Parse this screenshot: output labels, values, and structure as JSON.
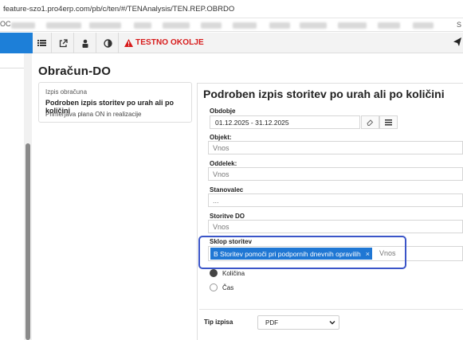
{
  "browser": {
    "url": "feature-szo1.pro4erp.com/pb/c/ten/#/TENAnalysis/TEN.REP.OBRDO"
  },
  "bookmarks": {
    "lead": "OC",
    "tail": "S"
  },
  "toolbar": {
    "buttons": [
      {
        "name": "list-icon"
      },
      {
        "name": "external-link-icon"
      },
      {
        "name": "user-lock-icon"
      },
      {
        "name": "contrast-icon"
      }
    ],
    "warning_label": "TESTNO OKOLJE",
    "warning_color": "#d71a1a",
    "accent": "#1d7fd8"
  },
  "page": {
    "title": "Obračun-DO"
  },
  "report_list": {
    "caption": "Izpis obračuna",
    "title": "Podroben izpis storitev po urah ali po količini",
    "subtitle": "Primerjava plana ON in realizacije"
  },
  "form": {
    "title": "Podroben izpis storitev po urah ali po količini",
    "obdobje": {
      "label": "Obdobje",
      "value": "01.12.2025 - 31.12.2025"
    },
    "objekt": {
      "label": "Objekt:",
      "placeholder": "Vnos"
    },
    "oddelek": {
      "label": "Oddelek:",
      "placeholder": "Vnos"
    },
    "stanovalec": {
      "label": "Stanovalec",
      "placeholder": "..."
    },
    "storitve": {
      "label": "Storitve DO",
      "placeholder": "Vnos"
    },
    "sklop": {
      "label": "Sklop storitev",
      "chip": "B Storitev pomoči pri podpornih dnevnih opravilih",
      "chip_remove": "×",
      "placeholder": "Vnos"
    },
    "mode": {
      "options": [
        {
          "label": "Količina",
          "selected": true
        },
        {
          "label": "Čas",
          "selected": false
        }
      ]
    },
    "tip_izpisa": {
      "label": "Tip izpisa",
      "value": "PDF"
    }
  }
}
